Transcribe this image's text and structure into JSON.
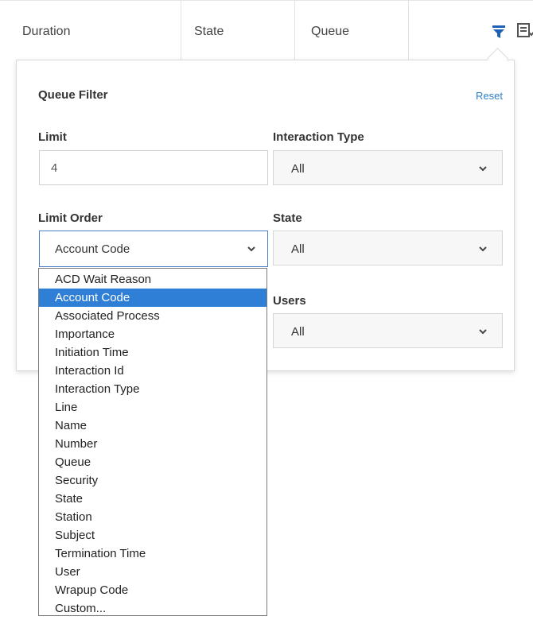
{
  "table": {
    "columns": [
      "Duration",
      "State",
      "Queue"
    ]
  },
  "icons": {
    "filter": "filter-icon",
    "columns": "column-picker-icon"
  },
  "filter_panel": {
    "title": "Queue Filter",
    "reset_label": "Reset",
    "limit": {
      "label": "Limit",
      "value": "4"
    },
    "interaction_type": {
      "label": "Interaction Type",
      "value": "All"
    },
    "limit_order": {
      "label": "Limit Order",
      "value": "Account Code",
      "options": [
        "ACD Wait Reason",
        "Account Code",
        "Associated Process",
        "Importance",
        "Initiation Time",
        "Interaction Id",
        "Interaction Type",
        "Line",
        "Name",
        "Number",
        "Queue",
        "Security",
        "State",
        "Station",
        "Subject",
        "Termination Time",
        "User",
        "Wrapup Code",
        "Custom..."
      ],
      "selected_index": 1
    },
    "state": {
      "label": "State",
      "value": "All"
    },
    "users": {
      "label": "Users",
      "value": "All"
    }
  },
  "colors": {
    "accent": "#2f7fd6",
    "filter_icon": "#1f5fb4",
    "reset_link": "#2f7fc8"
  }
}
